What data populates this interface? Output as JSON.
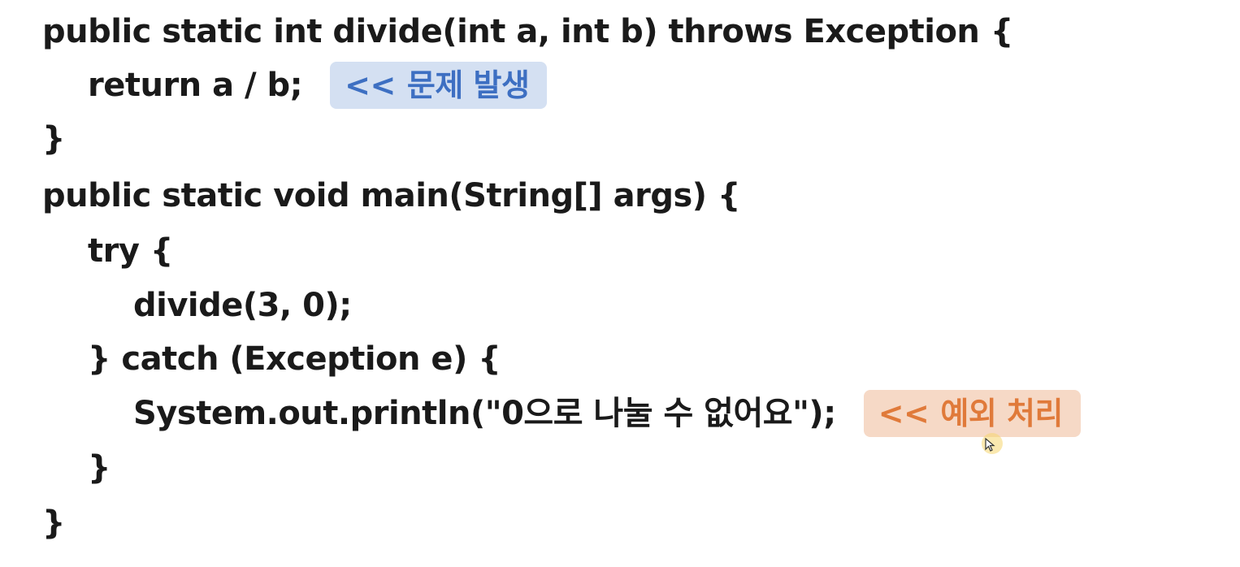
{
  "code": {
    "lines": [
      "public static int divide(int a, int b) throws Exception {",
      "return a / b;",
      "}",
      "public static void main(String[] args) {",
      "try {",
      "divide(3, 0);",
      "} catch (Exception e) {",
      "System.out.println(\"0으로 나눌 수 없어요\");",
      "}",
      "}"
    ]
  },
  "annotations": {
    "problem": {
      "arrow": "<<",
      "label": "문제 발생",
      "color": "#3d6fc2",
      "background": "#d4e0f2"
    },
    "handling": {
      "arrow": "<<",
      "label": "예외 처리",
      "color": "#e07a3a",
      "background": "#f6d9c6"
    }
  },
  "icons": {
    "cursor": "mouse-pointer-icon"
  }
}
